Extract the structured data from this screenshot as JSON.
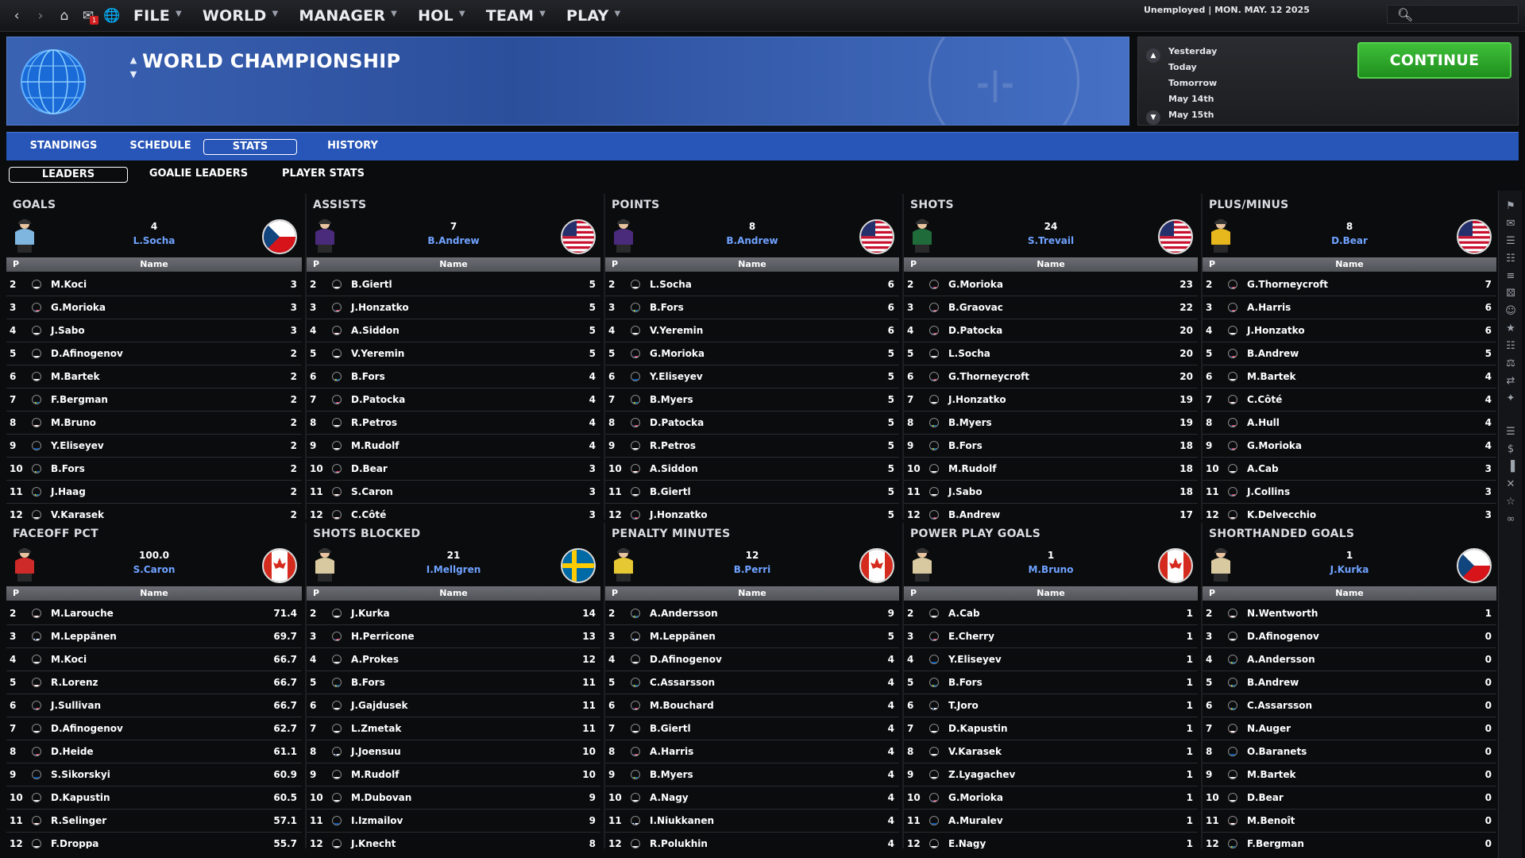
{
  "nav": {
    "icons": [
      "back-icon",
      "forward-icon",
      "home-icon",
      "mail-icon",
      "globe-icon"
    ],
    "mail_badge": "1"
  },
  "menu": [
    {
      "label": "FILE"
    },
    {
      "label": "WORLD"
    },
    {
      "label": "MANAGER"
    },
    {
      "label": "HOL"
    },
    {
      "label": "TEAM"
    },
    {
      "label": "PLAY"
    }
  ],
  "status": "Unemployed | MON. MAY. 12 2025",
  "search": {
    "placeholder": ""
  },
  "header": {
    "title": "WORLD CHAMPIONSHIP"
  },
  "dates": [
    "Yesterday",
    "Today",
    "Tomorrow",
    "May 14th",
    "May 15th"
  ],
  "continue_label": "CONTINUE",
  "tabs": [
    "STANDINGS",
    "SCHEDULE",
    "STATS",
    "HISTORY"
  ],
  "subtabs": [
    "LEADERS",
    "GOALIE LEADERS",
    "PLAYER STATS"
  ],
  "table_header": {
    "p": "P",
    "name": "Name"
  },
  "panels": [
    {
      "title": "GOALS",
      "leader_value": "4",
      "leader_name": "L.Socha",
      "leader_flag": "cz",
      "jersey": "#7fb6e0",
      "rows": [
        [
          "2",
          "cz",
          "M.Koci",
          "3"
        ],
        [
          "3",
          "us",
          "G.Morioka",
          "3"
        ],
        [
          "4",
          "sk",
          "J.Sabo",
          "3"
        ],
        [
          "5",
          "ru",
          "D.Afinogenov",
          "2"
        ],
        [
          "6",
          "cz",
          "M.Bartek",
          "2"
        ],
        [
          "7",
          "se",
          "F.Bergman",
          "2"
        ],
        [
          "8",
          "ca",
          "M.Bruno",
          "2"
        ],
        [
          "9",
          "ua",
          "Y.Eliseyev",
          "2"
        ],
        [
          "10",
          "se",
          "B.Fors",
          "2"
        ],
        [
          "11",
          "se",
          "J.Haag",
          "2"
        ],
        [
          "12",
          "cz",
          "V.Karasek",
          "2"
        ]
      ]
    },
    {
      "title": "ASSISTS",
      "leader_value": "7",
      "leader_name": "B.Andrew",
      "leader_flag": "us",
      "jersey": "#4a2a7a",
      "rows": [
        [
          "2",
          "sk",
          "B.Giertl",
          "5"
        ],
        [
          "3",
          "us",
          "J.Honzatko",
          "5"
        ],
        [
          "4",
          "ca",
          "A.Siddon",
          "5"
        ],
        [
          "5",
          "ru",
          "V.Yeremin",
          "5"
        ],
        [
          "6",
          "se",
          "B.Fors",
          "4"
        ],
        [
          "7",
          "us",
          "D.Patocka",
          "4"
        ],
        [
          "8",
          "sk",
          "R.Petros",
          "4"
        ],
        [
          "9",
          "sk",
          "M.Rudolf",
          "4"
        ],
        [
          "10",
          "us",
          "D.Bear",
          "3"
        ],
        [
          "11",
          "ca",
          "S.Caron",
          "3"
        ],
        [
          "12",
          "ca",
          "C.Côté",
          "3"
        ]
      ]
    },
    {
      "title": "POINTS",
      "leader_value": "8",
      "leader_name": "B.Andrew",
      "leader_flag": "us",
      "jersey": "#4a2a7a",
      "rows": [
        [
          "2",
          "cz",
          "L.Socha",
          "6"
        ],
        [
          "3",
          "se",
          "B.Fors",
          "6"
        ],
        [
          "4",
          "ru",
          "V.Yeremin",
          "6"
        ],
        [
          "5",
          "us",
          "G.Morioka",
          "5"
        ],
        [
          "6",
          "ua",
          "Y.Eliseyev",
          "5"
        ],
        [
          "7",
          "se",
          "B.Myers",
          "5"
        ],
        [
          "8",
          "us",
          "D.Patocka",
          "5"
        ],
        [
          "9",
          "sk",
          "R.Petros",
          "5"
        ],
        [
          "10",
          "ca",
          "A.Siddon",
          "5"
        ],
        [
          "11",
          "sk",
          "B.Giertl",
          "5"
        ],
        [
          "12",
          "us",
          "J.Honzatko",
          "5"
        ]
      ]
    },
    {
      "title": "SHOTS",
      "leader_value": "24",
      "leader_name": "S.Trevail",
      "leader_flag": "us",
      "jersey": "#1f6b3a",
      "rows": [
        [
          "2",
          "us",
          "G.Morioka",
          "23"
        ],
        [
          "3",
          "us",
          "B.Graovac",
          "22"
        ],
        [
          "4",
          "us",
          "D.Patocka",
          "20"
        ],
        [
          "5",
          "cz",
          "L.Socha",
          "20"
        ],
        [
          "6",
          "us",
          "G.Thorneycroft",
          "20"
        ],
        [
          "7",
          "cz",
          "J.Honzatko",
          "19"
        ],
        [
          "8",
          "se",
          "B.Myers",
          "19"
        ],
        [
          "9",
          "se",
          "B.Fors",
          "18"
        ],
        [
          "10",
          "sk",
          "M.Rudolf",
          "18"
        ],
        [
          "11",
          "sk",
          "J.Sabo",
          "18"
        ],
        [
          "12",
          "us",
          "B.Andrew",
          "17"
        ]
      ]
    },
    {
      "title": "PLUS/MINUS",
      "leader_value": "8",
      "leader_name": "D.Bear",
      "leader_flag": "us",
      "jersey": "#e6b81e",
      "rows": [
        [
          "2",
          "us",
          "G.Thorneycroft",
          "7"
        ],
        [
          "3",
          "us",
          "A.Harris",
          "6"
        ],
        [
          "4",
          "cz",
          "J.Honzatko",
          "6"
        ],
        [
          "5",
          "us",
          "B.Andrew",
          "5"
        ],
        [
          "6",
          "cz",
          "M.Bartek",
          "4"
        ],
        [
          "7",
          "ca",
          "C.Côté",
          "4"
        ],
        [
          "8",
          "us",
          "A.Hull",
          "4"
        ],
        [
          "9",
          "us",
          "G.Morioka",
          "4"
        ],
        [
          "10",
          "cz",
          "A.Cab",
          "3"
        ],
        [
          "11",
          "us",
          "J.Collins",
          "3"
        ],
        [
          "12",
          "ca",
          "K.Delvecchio",
          "3"
        ]
      ]
    },
    {
      "title": "FACEOFF PCT",
      "leader_value": "100.0",
      "leader_name": "S.Caron",
      "leader_flag": "ca",
      "jersey": "#cf2a2a",
      "rows": [
        [
          "2",
          "ca",
          "M.Larouche",
          "71.4"
        ],
        [
          "3",
          "fi",
          "M.Leppänen",
          "69.7"
        ],
        [
          "4",
          "cz",
          "M.Koci",
          "66.7"
        ],
        [
          "5",
          "ca",
          "R.Lorenz",
          "66.7"
        ],
        [
          "6",
          "us",
          "J.Sullivan",
          "66.7"
        ],
        [
          "7",
          "ru",
          "D.Afinogenov",
          "62.7"
        ],
        [
          "8",
          "us",
          "D.Heide",
          "61.1"
        ],
        [
          "9",
          "ua",
          "S.Sikorskyi",
          "60.9"
        ],
        [
          "10",
          "ru",
          "D.Kapustin",
          "60.5"
        ],
        [
          "11",
          "ca",
          "R.Selinger",
          "57.1"
        ],
        [
          "12",
          "sk",
          "F.Droppa",
          "55.7"
        ]
      ]
    },
    {
      "title": "SHOTS BLOCKED",
      "leader_value": "21",
      "leader_name": "I.Mellgren",
      "leader_flag": "se",
      "jersey": "#d9c9a0",
      "rows": [
        [
          "2",
          "cz",
          "J.Kurka",
          "14"
        ],
        [
          "3",
          "us",
          "H.Perricone",
          "13"
        ],
        [
          "4",
          "cz",
          "A.Prokes",
          "12"
        ],
        [
          "5",
          "se",
          "B.Fors",
          "11"
        ],
        [
          "6",
          "sk",
          "J.Gajdusek",
          "11"
        ],
        [
          "7",
          "sk",
          "L.Zmetak",
          "11"
        ],
        [
          "8",
          "fi",
          "J.Joensuu",
          "10"
        ],
        [
          "9",
          "sk",
          "M.Rudolf",
          "10"
        ],
        [
          "10",
          "sk",
          "M.Dubovan",
          "9"
        ],
        [
          "11",
          "ua",
          "I.Izmailov",
          "9"
        ],
        [
          "12",
          "cz",
          "J.Knecht",
          "8"
        ]
      ]
    },
    {
      "title": "PENALTY MINUTES",
      "leader_value": "12",
      "leader_name": "B.Perri",
      "leader_flag": "ca",
      "jersey": "#e6c832",
      "rows": [
        [
          "2",
          "se",
          "A.Andersson",
          "9"
        ],
        [
          "3",
          "fi",
          "M.Leppänen",
          "5"
        ],
        [
          "4",
          "ru",
          "D.Afinogenov",
          "4"
        ],
        [
          "5",
          "se",
          "C.Assarsson",
          "4"
        ],
        [
          "6",
          "us",
          "M.Bouchard",
          "4"
        ],
        [
          "7",
          "sk",
          "B.Giertl",
          "4"
        ],
        [
          "8",
          "us",
          "A.Harris",
          "4"
        ],
        [
          "9",
          "se",
          "B.Myers",
          "4"
        ],
        [
          "10",
          "sk",
          "A.Nagy",
          "4"
        ],
        [
          "11",
          "fi",
          "I.Niukkanen",
          "4"
        ],
        [
          "12",
          "ru",
          "R.Polukhin",
          "4"
        ]
      ]
    },
    {
      "title": "POWER PLAY GOALS",
      "leader_value": "1",
      "leader_name": "M.Bruno",
      "leader_flag": "ca",
      "jersey": "#d9c9a0",
      "rows": [
        [
          "2",
          "cz",
          "A.Cab",
          "1"
        ],
        [
          "3",
          "us",
          "E.Cherry",
          "1"
        ],
        [
          "4",
          "ua",
          "Y.Eliseyev",
          "1"
        ],
        [
          "5",
          "se",
          "B.Fors",
          "1"
        ],
        [
          "6",
          "fi",
          "T.Joro",
          "1"
        ],
        [
          "7",
          "ru",
          "D.Kapustin",
          "1"
        ],
        [
          "8",
          "cz",
          "V.Karasek",
          "1"
        ],
        [
          "9",
          "ru",
          "Z.Lyagachev",
          "1"
        ],
        [
          "10",
          "us",
          "G.Morioka",
          "1"
        ],
        [
          "11",
          "ua",
          "A.Muralev",
          "1"
        ],
        [
          "12",
          "sk",
          "E.Nagy",
          "1"
        ]
      ]
    },
    {
      "title": "SHORTHANDED GOALS",
      "leader_value": "1",
      "leader_name": "J.Kurka",
      "leader_flag": "cz",
      "jersey": "#d9c9a0",
      "rows": [
        [
          "2",
          "ca",
          "N.Wentworth",
          "1"
        ],
        [
          "3",
          "ru",
          "D.Afinogenov",
          "0"
        ],
        [
          "4",
          "se",
          "A.Andersson",
          "0"
        ],
        [
          "5",
          "se",
          "B.Andrew",
          "0"
        ],
        [
          "6",
          "se",
          "C.Assarsson",
          "0"
        ],
        [
          "7",
          "ca",
          "N.Auger",
          "0"
        ],
        [
          "8",
          "ua",
          "O.Baranets",
          "0"
        ],
        [
          "9",
          "cz",
          "M.Bartek",
          "0"
        ],
        [
          "10",
          "cz",
          "D.Bear",
          "0"
        ],
        [
          "11",
          "ca",
          "M.Benoît",
          "0"
        ],
        [
          "12",
          "se",
          "F.Bergman",
          "0"
        ]
      ]
    }
  ],
  "rail_icons": [
    "flag-usa-icon",
    "mail-icon",
    "list-icon",
    "chart-icon",
    "menu-icon",
    "dice-icon",
    "people-icon",
    "trophy-icon",
    "clipboard-icon",
    "scale-icon",
    "transfer-icon",
    "award-icon",
    "list2-icon",
    "money-icon",
    "bars-icon",
    "whistle-icon",
    "cup-icon",
    "glasses-icon"
  ]
}
